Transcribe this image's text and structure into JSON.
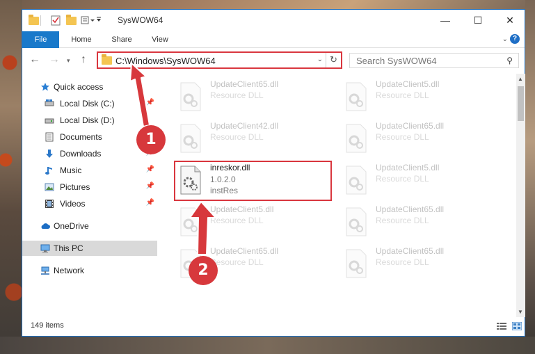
{
  "window": {
    "title": "SysWOW64",
    "minimize_glyph": "—",
    "maximize_glyph": "☐",
    "close_glyph": "✕"
  },
  "ribbon": {
    "tabs": [
      {
        "label": "File"
      },
      {
        "label": "Home"
      },
      {
        "label": "Share"
      },
      {
        "label": "View"
      }
    ],
    "help_glyph": "?"
  },
  "address": {
    "path": "C:\\Windows\\SysWOW64",
    "search_placeholder": "Search SysWOW64"
  },
  "sidebar": {
    "items": [
      {
        "label": "Quick access",
        "icon": "star-icon"
      },
      {
        "label": "Local Disk (C:)",
        "icon": "drive-icon"
      },
      {
        "label": "Local Disk (D:)",
        "icon": "drive-icon"
      },
      {
        "label": "Documents",
        "icon": "documents-icon"
      },
      {
        "label": "Downloads",
        "icon": "download-icon"
      },
      {
        "label": "Music",
        "icon": "music-icon"
      },
      {
        "label": "Pictures",
        "icon": "pictures-icon"
      },
      {
        "label": "Videos",
        "icon": "videos-icon"
      },
      {
        "label": "OneDrive",
        "icon": "cloud-icon"
      },
      {
        "label": "This PC",
        "icon": "computer-icon"
      },
      {
        "label": "Network",
        "icon": "network-icon"
      }
    ]
  },
  "files": [
    {
      "name": "UpdateClient65.dll",
      "line1": "Resource DLL"
    },
    {
      "name": "UpdateClient5.dll",
      "line1": "Resource DLL"
    },
    {
      "name": "UpdateClient42.dll",
      "line1": "Resource DLL"
    },
    {
      "name": "UpdateClient65.dll",
      "line1": "Resource DLL"
    },
    {
      "name": "inreskor.dll",
      "line1": "1.0.2.0",
      "line2": "instRes"
    },
    {
      "name": "UpdateClient5.dll",
      "line1": "Resource DLL"
    },
    {
      "name": "UpdateClient5.dll",
      "line1": "Resource DLL"
    },
    {
      "name": "UpdateClient65.dll",
      "line1": "Resource DLL"
    },
    {
      "name": "UpdateClient65.dll",
      "line1": "Resource DLL"
    },
    {
      "name": "UpdateClient65.dll",
      "line1": "Resource DLL"
    }
  ],
  "status": {
    "item_count": "149 items"
  },
  "annotations": {
    "step1": "1",
    "step2": "2",
    "color": "#d7383c"
  }
}
